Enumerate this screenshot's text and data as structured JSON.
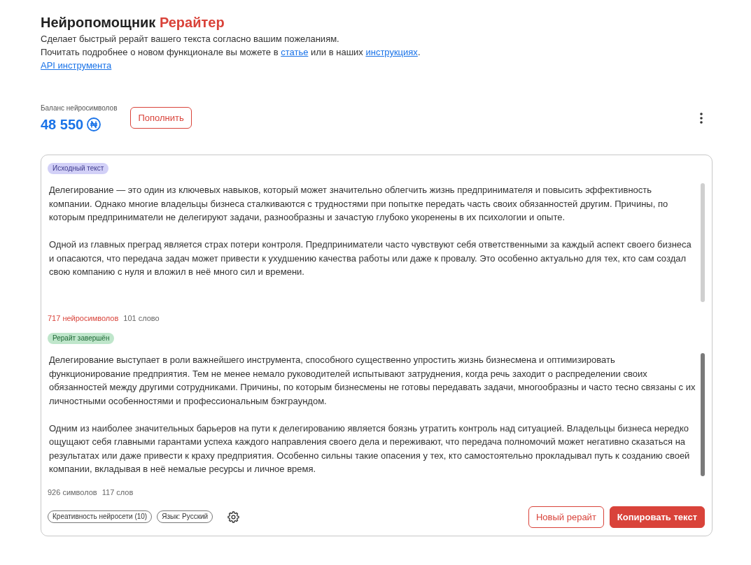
{
  "header": {
    "title": "Нейропомощник",
    "title_accent": "Рерайтер",
    "description": "Сделает быстрый рерайт вашего текста согласно вашим пожеланиям.",
    "info": [
      {
        "kind": "text",
        "text": "Почитать подробнее о новом функционале вы можете в "
      },
      {
        "kind": "link",
        "text": "статье"
      },
      {
        "kind": "text",
        "text": " или в наших "
      },
      {
        "kind": "link",
        "text": "инструкциях"
      },
      {
        "kind": "text",
        "text": "."
      }
    ],
    "api_link": "API инструмента"
  },
  "balance": {
    "label": "Баланс нейросимволов",
    "value": "48 550",
    "top_up_button": "Пополнить"
  },
  "panels": [
    {
      "kind": "source",
      "badge": "Исходный текст",
      "paragraphs": [
        "Делегирование — это один из ключевых навыков, который может значительно облегчить жизнь предпринимателя и повысить эффективность компании. Однако многие владельцы бизнеса сталкиваются с трудностями при попытке передать часть своих обязанностей другим. Причины, по которым предприниматели не делегируют задачи, разнообразны и зачастую глубоко укоренены в их психологии и опыте.",
        "Одной из главных преград является страх потери контроля. Предприниматели часто чувствуют себя ответственными за каждый аспект своего бизнеса и опасаются, что передача задач может привести к ухудшению качества работы или даже к провалу. Это особенно актуально для тех, кто сам создал свою компанию с нуля и вложил в неё много сил и времени."
      ],
      "counts": [
        {
          "kind": "accent",
          "text": "717 нейросимволов"
        },
        {
          "kind": "plain",
          "text": "101 слово"
        }
      ]
    },
    {
      "kind": "result",
      "badge": "Рерайт завершён",
      "paragraphs": [
        "Делегирование выступает в роли важнейшего инструмента, способного существенно упростить жизнь бизнесмена и оптимизировать функционирование предприятия. Тем не менее немало руководителей испытывают затруднения, когда речь заходит о распределении своих обязанностей между другими сотрудниками. Причины, по которым бизнесмены не готовы передавать задачи, многообразны и часто тесно связаны с их личностными особенностями и профессиональным бэкграундом.",
        "Одним из наиболее значительных барьеров на пути к делегированию является боязнь утратить контроль над ситуацией. Владельцы бизнеса нередко ощущают себя главными гарантами успеха каждого направления своего дела и переживают, что передача полномочий может негативно сказаться на результатах или даже привести к краху предприятия. Особенно сильны такие опасения у тех, кто самостоятельно прокладывал путь к созданию своей компании, вкладывая в неё немалые ресурсы и личное время."
      ],
      "counts": [
        {
          "kind": "plain",
          "text": "926 символов"
        },
        {
          "kind": "plain",
          "text": "117 слов"
        }
      ]
    }
  ],
  "settings_chips": [
    "Креативность нейросети (10)",
    "Язык: Русский"
  ],
  "actions": [
    {
      "kind": "outline",
      "label": "Новый рерайт"
    },
    {
      "kind": "primary",
      "label": "Копировать текст"
    }
  ]
}
